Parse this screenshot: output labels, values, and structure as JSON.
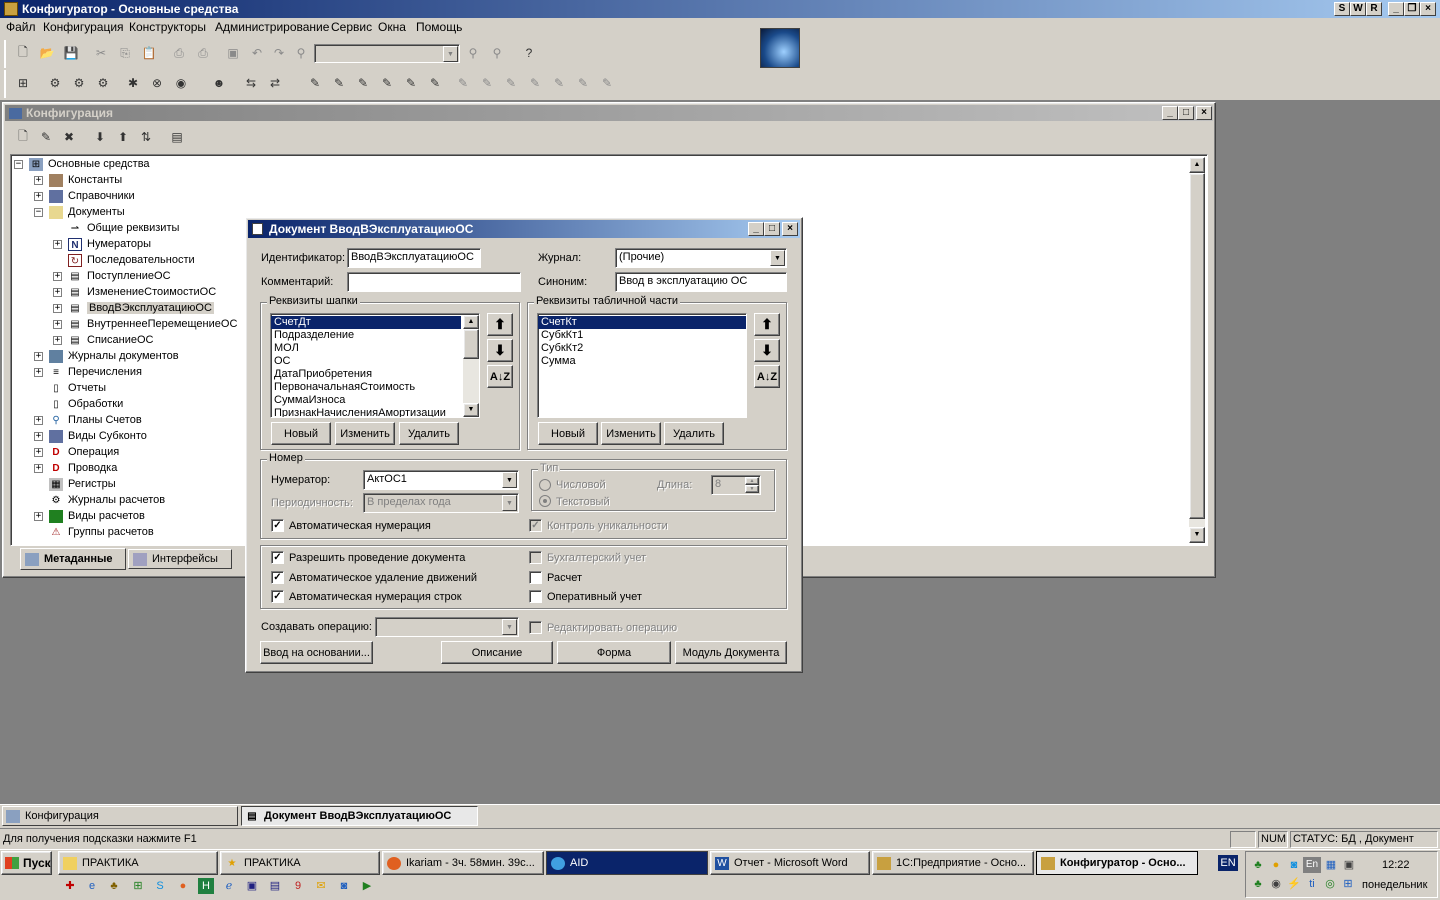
{
  "app": {
    "title": "Конфигуратор - Основные средства",
    "title_controls": [
      "S",
      "W",
      "R"
    ]
  },
  "menu": [
    "Файл",
    "Конфигурация",
    "Конструкторы",
    "Администрирование",
    "Сервис",
    "Окна",
    "Помощь"
  ],
  "config_window": {
    "title": "Конфигурация",
    "tree": [
      {
        "label": "Основные средства",
        "expander": "−"
      },
      {
        "label": "Константы",
        "expander": "+"
      },
      {
        "label": "Справочники",
        "expander": "+"
      },
      {
        "label": "Документы",
        "expander": "−"
      },
      {
        "label": "Общие реквизиты",
        "expander": ""
      },
      {
        "label": "Нумераторы",
        "expander": "+"
      },
      {
        "label": "Последовательности",
        "expander": ""
      },
      {
        "label": "ПоступлениеОС",
        "expander": "+"
      },
      {
        "label": "ИзменениеСтоимостиОС",
        "expander": "+"
      },
      {
        "label": "ВводВЭксплуатациюОС",
        "expander": "+"
      },
      {
        "label": "ВнутреннееПеремещениеОС",
        "expander": "+"
      },
      {
        "label": "СписаниеОС",
        "expander": "+"
      },
      {
        "label": "Журналы документов",
        "expander": "+"
      },
      {
        "label": "Перечисления",
        "expander": "+"
      },
      {
        "label": "Отчеты",
        "expander": ""
      },
      {
        "label": "Обработки",
        "expander": ""
      },
      {
        "label": "Планы Счетов",
        "expander": "+"
      },
      {
        "label": "Виды Субконто",
        "expander": "+"
      },
      {
        "label": "Операция",
        "expander": "+"
      },
      {
        "label": "Проводка",
        "expander": "+"
      },
      {
        "label": "Регистры",
        "expander": ""
      },
      {
        "label": "Журналы расчетов",
        "expander": ""
      },
      {
        "label": "Виды расчетов",
        "expander": "+"
      },
      {
        "label": "Группы расчетов",
        "expander": ""
      }
    ],
    "tabs": [
      "Метаданные",
      "Интерфейсы"
    ]
  },
  "doc_dialog": {
    "title": "Документ ВводВЭксплуатациюОС",
    "identifier_label": "Идентификатор:",
    "identifier": "ВводВЭксплуатациюОС",
    "comment_label": "Комментарий:",
    "comment": "",
    "journal_label": "Журнал:",
    "journal": "(Прочие)",
    "synonym_label": "Синоним:",
    "synonym": "Ввод в эксплуатацию ОС",
    "header_group": "Реквизиты шапки",
    "header_items": [
      "СчетДт",
      "Подразделение",
      "МОЛ",
      "ОС",
      "ДатаПриобретения",
      "ПервоначальнаяСтоимость",
      "СуммаИзноса",
      "ПризнакНачисленияАмортизации"
    ],
    "table_group": "Реквизиты табличной части",
    "table_items": [
      "СчетКт",
      "СубкКт1",
      "СубкКт2",
      "Сумма"
    ],
    "btn_new": "Новый",
    "btn_edit": "Изменить",
    "btn_delete": "Удалить",
    "number_group": "Номер",
    "numerator_label": "Нумератор:",
    "numerator": "АктОС1",
    "period_label": "Периодичность:",
    "period": "В пределах года",
    "auto_num": "Автоматическая нумерация",
    "type_group": "Тип",
    "type_numeric": "Числовой",
    "type_text": "Текстовый",
    "length_label": "Длина:",
    "length": "8",
    "unique_ctrl": "Контроль уникальности",
    "allow_post": "Разрешить проведение документа",
    "auto_delete": "Автоматическое удаление движений",
    "auto_line_num": "Автоматическая нумерация строк",
    "accounting": "Бухгалтерский учет",
    "calculation": "Расчет",
    "operational": "Оперативный учет",
    "create_op_label": "Создавать операцию:",
    "edit_op": "Редактировать операцию",
    "btn_based_on": "Ввод на основании...",
    "btn_description": "Описание",
    "btn_form": "Форма",
    "btn_module": "Модуль Документа"
  },
  "mdi_tabs": [
    "Конфигурация",
    "Документ ВводВЭксплуатациюОС"
  ],
  "status": {
    "hint": "Для получения подсказки нажмите F1",
    "num": "NUM",
    "state": "СТАТУС: БД , Документ"
  },
  "taskbar": {
    "start": "Пуск",
    "tasks": [
      "ПРАКТИКА",
      "ПРАКТИКА",
      "Ikariam - 3ч. 58мин. 39с...",
      "AID",
      "Отчет - Microsoft Word",
      "1С:Предприятие - Осно...",
      "Конфигуратор - Осно..."
    ],
    "lang": "EN",
    "tray_lang": "En",
    "time": "12:22",
    "day": "понедельник"
  }
}
